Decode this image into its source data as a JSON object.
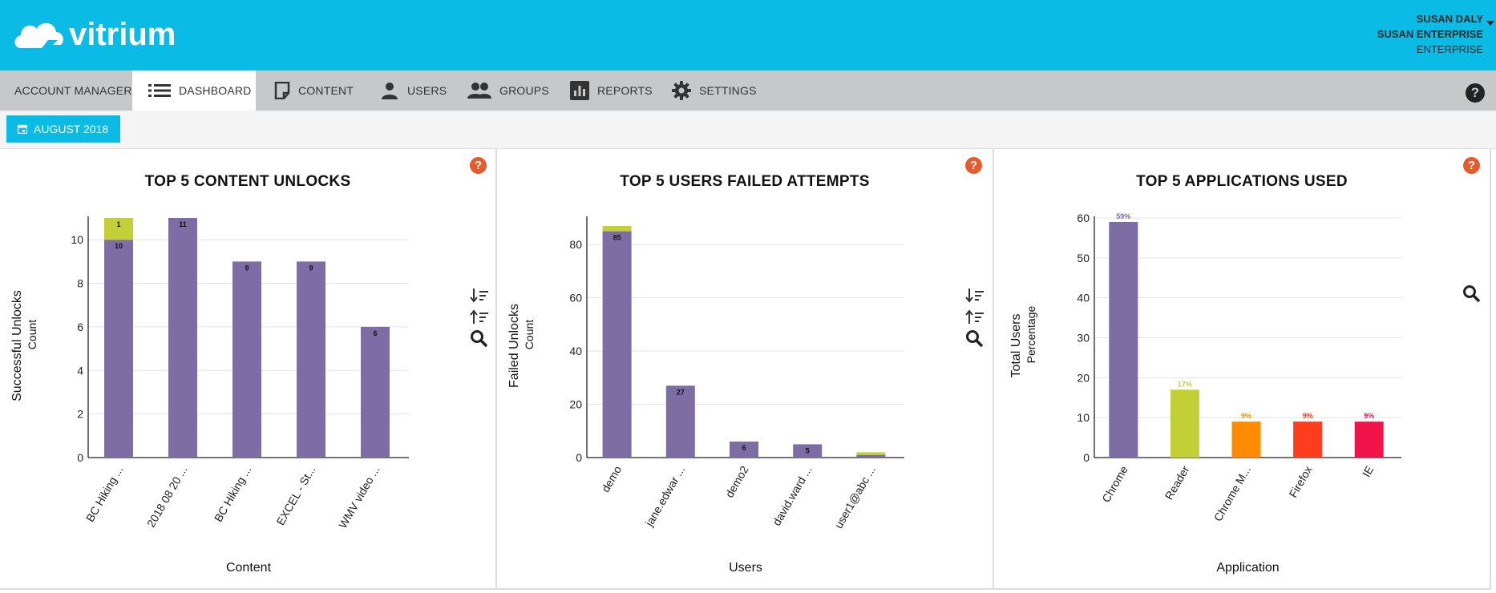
{
  "app": {
    "logo_text": "vitrium",
    "user_name": "SUSAN DALY",
    "company": "SUSAN ENTERPRISE",
    "plan": "ENTERPRISE"
  },
  "nav": {
    "items": [
      {
        "label": "ACCOUNT MANAGER",
        "icon": "none"
      },
      {
        "label": "DASHBOARD",
        "icon": "list-icon",
        "active": true
      },
      {
        "label": "CONTENT",
        "icon": "document-icon"
      },
      {
        "label": "USERS",
        "icon": "user-icon"
      },
      {
        "label": "GROUPS",
        "icon": "group-icon"
      },
      {
        "label": "REPORTS",
        "icon": "bar-chart-icon"
      },
      {
        "label": "SETTINGS",
        "icon": "gear-icon"
      }
    ],
    "help": "?"
  },
  "toolbar": {
    "date_label": "AUGUST 2018"
  },
  "colors": {
    "header": "#0abbe6",
    "purple": "#7c6da4",
    "lime": "#c2cf35",
    "orange": "#ff8c00",
    "red_orange": "#ff3c1e",
    "crimson": "#f0144b",
    "help": "#e75a2c"
  },
  "panels": [
    {
      "title": "TOP 5 CONTENT UNLOCKS",
      "help": "?"
    },
    {
      "title": "TOP 5 USERS FAILED ATTEMPTS",
      "help": "?"
    },
    {
      "title": "TOP 5 APPLICATIONS USED",
      "help": "?"
    }
  ],
  "chart_data": [
    {
      "type": "bar",
      "stacked": true,
      "title": "TOP 5 CONTENT UNLOCKS",
      "xlabel": "Content",
      "ylabel": "Successful Unlocks",
      "ylabel_sub": "Count",
      "categories": [
        "BC Hiking ...",
        "2018 08 20 ...",
        "BC Hiking ...",
        "EXCEL - St...",
        "WMV video ..."
      ],
      "series": [
        {
          "color": "#7c6da4",
          "values": [
            10,
            11,
            9,
            9,
            6
          ]
        },
        {
          "color": "#c2cf35",
          "values": [
            1,
            0,
            0,
            0,
            0
          ]
        }
      ],
      "yticks": [
        0,
        2,
        4,
        6,
        8,
        10
      ],
      "ylim": [
        0,
        11
      ],
      "grid": true
    },
    {
      "type": "bar",
      "stacked": true,
      "title": "TOP 5 USERS FAILED ATTEMPTS",
      "xlabel": "Users",
      "ylabel": "Failed Unlocks",
      "ylabel_sub": "Count",
      "categories": [
        "demo",
        "jane.edwar ...",
        "demo2",
        "david.ward ...",
        "user1@abc ..."
      ],
      "series": [
        {
          "color": "#7c6da4",
          "values": [
            85,
            27,
            6,
            5,
            1
          ]
        },
        {
          "color": "#c2cf35",
          "values": [
            2,
            0,
            0,
            0,
            1
          ]
        }
      ],
      "value_labels": [
        "85",
        "27",
        "6",
        "5",
        ""
      ],
      "yticks": [
        0,
        20,
        40,
        60,
        80
      ],
      "ylim": [
        0,
        90
      ],
      "grid": true
    },
    {
      "type": "bar",
      "title": "TOP 5 APPLICATIONS USED",
      "xlabel": "Application",
      "ylabel": "Total Users",
      "ylabel_sub": "Percentage",
      "categories": [
        "Chrome",
        "Reader",
        "Chrome M...",
        "Firefox",
        "IE"
      ],
      "values": [
        59,
        17,
        9,
        9,
        9
      ],
      "value_labels": [
        "59%",
        "17%",
        "9%",
        "9%",
        "9%"
      ],
      "colors": [
        "#7c6da4",
        "#c2cf35",
        "#ff8c00",
        "#ff3c1e",
        "#f0144b"
      ],
      "yticks": [
        0,
        10,
        20,
        30,
        40,
        50,
        60
      ],
      "ylim": [
        0,
        60
      ],
      "grid": true
    }
  ]
}
